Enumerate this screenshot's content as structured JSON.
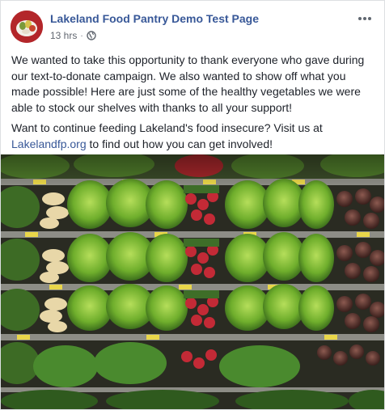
{
  "post": {
    "page_name": "Lakeland Food Pantry Demo Test Page",
    "timestamp": "13 hrs",
    "separator": "·",
    "privacy_icon": "globe-icon",
    "more_icon": "more-options-icon",
    "paragraph1": "We wanted to take this opportunity to thank everyone who gave during our text-to-donate campaign. We also wanted to show off what you made possible! Here are just some of the healthy vegetables we were able to stock our shelves with thanks to all your support!",
    "paragraph2_before": "Want to continue feeding Lakeland's food insecure? Visit us at ",
    "link_text": "Lakelandfp.org",
    "paragraph2_after": " to find out how you can get involved!"
  },
  "colors": {
    "link": "#385898",
    "meta": "#616770",
    "border": "#dddfe2"
  }
}
